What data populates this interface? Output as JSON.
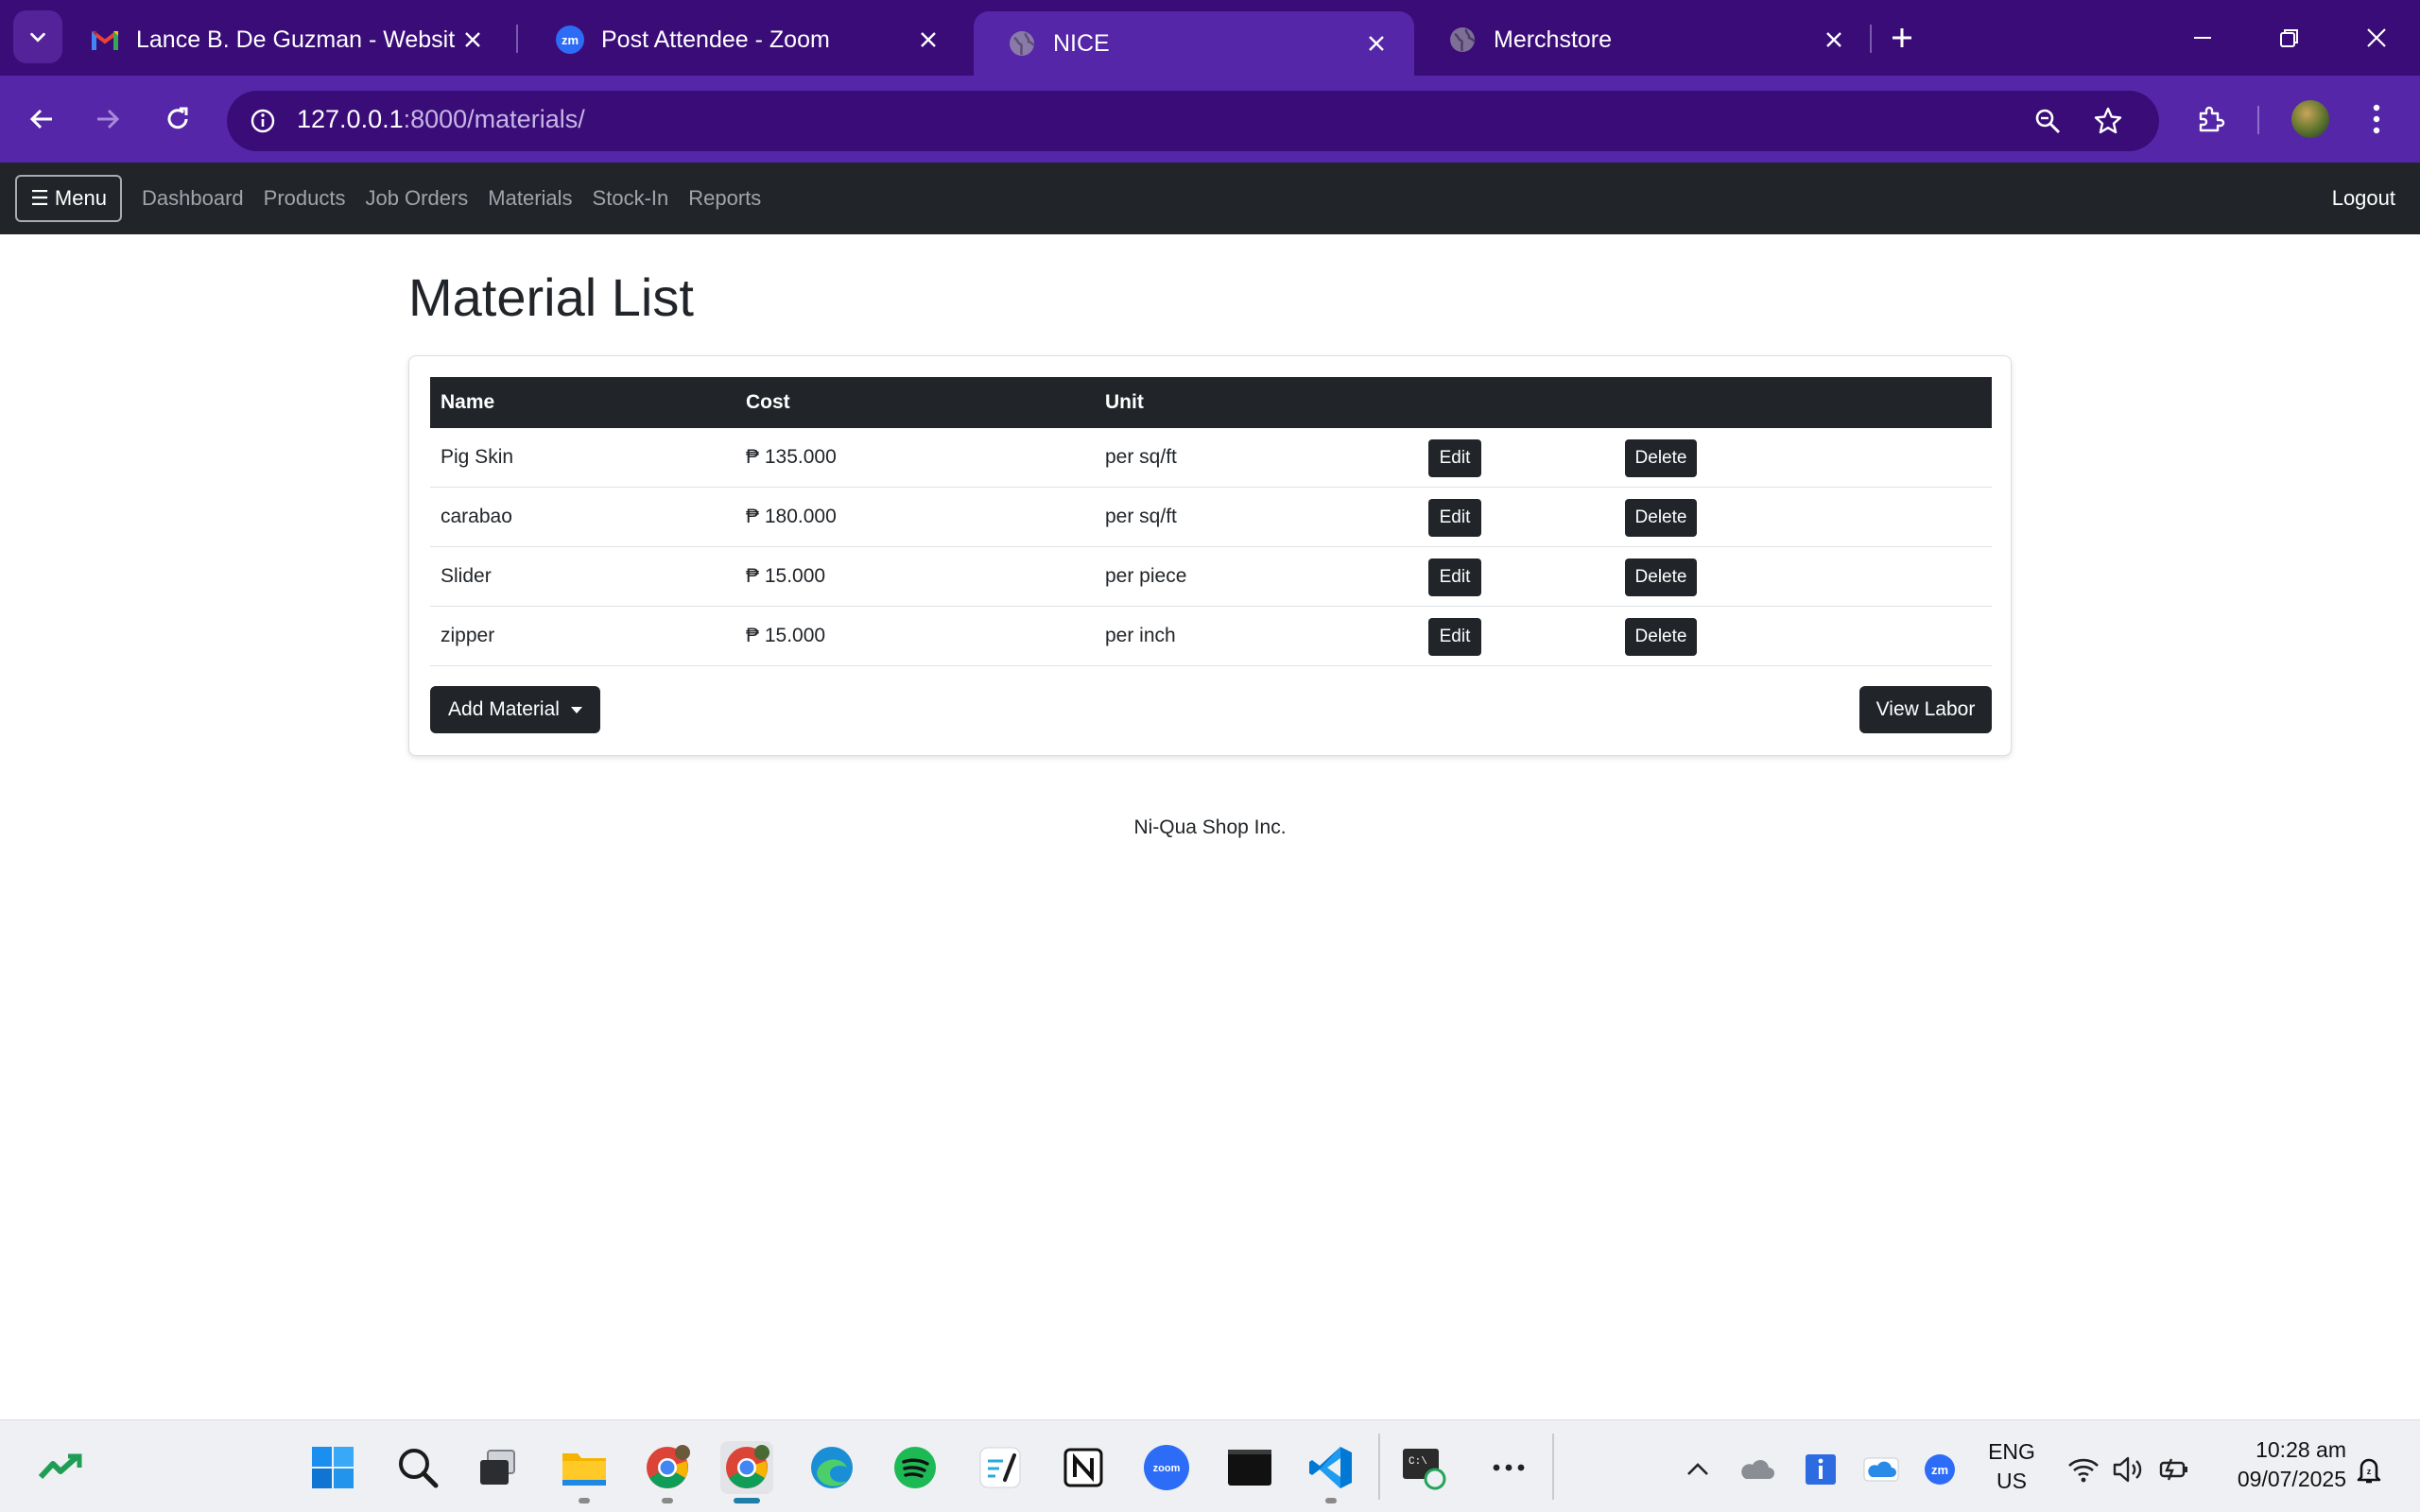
{
  "browser": {
    "tabs": [
      {
        "title": "Lance B. De Guzman - Website",
        "icon": "gmail-icon"
      },
      {
        "title": "Post Attendee - Zoom",
        "icon": "zoom-icon"
      },
      {
        "title": "NICE",
        "icon": "globe-icon",
        "active": true
      },
      {
        "title": "Merchstore",
        "icon": "globe-icon"
      }
    ],
    "url_host": "127.0.0.1",
    "url_rest": ":8000/materials/"
  },
  "navbar": {
    "menu_label": "☰ Menu",
    "links": [
      "Dashboard",
      "Products",
      "Job Orders",
      "Materials",
      "Stock-In",
      "Reports"
    ],
    "logout": "Logout"
  },
  "page": {
    "title": "Material List",
    "columns": [
      "Name",
      "Cost",
      "Unit"
    ],
    "rows": [
      {
        "name": "Pig Skin",
        "cost": "₱ 135.000",
        "unit": "per sq/ft"
      },
      {
        "name": "carabao",
        "cost": "₱ 180.000",
        "unit": "per sq/ft"
      },
      {
        "name": "Slider",
        "cost": "₱ 15.000",
        "unit": "per piece"
      },
      {
        "name": "zipper",
        "cost": "₱ 15.000",
        "unit": "per inch"
      }
    ],
    "edit_label": "Edit",
    "delete_label": "Delete",
    "add_label": "Add Material",
    "view_labor_label": "View Labor",
    "footer": "Ni-Qua Shop Inc."
  },
  "taskbar": {
    "lang_line1": "ENG",
    "lang_line2": "US",
    "time": "10:28 am",
    "date": "09/07/2025"
  },
  "colors": {
    "tab_strip": "#3a0c78",
    "browser_toolbar": "#5626a8",
    "navbar": "#212529",
    "button_dark": "#212529"
  }
}
